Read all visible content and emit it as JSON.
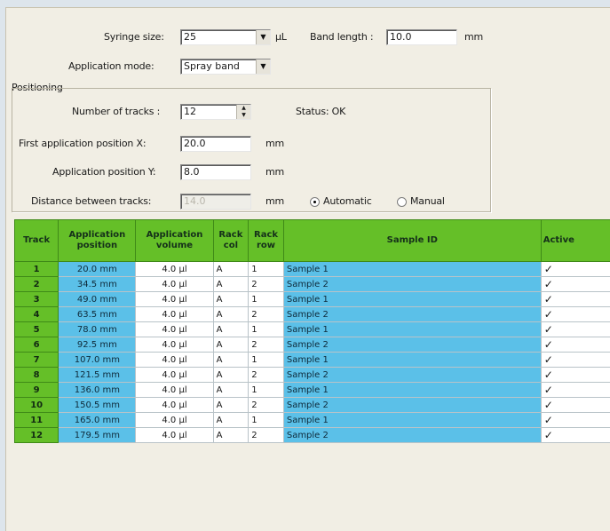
{
  "form": {
    "syringe_label": "Syringe size:",
    "syringe_value": "25",
    "syringe_unit": "µL",
    "band_label": "Band length :",
    "band_value": "10.0",
    "band_unit": "mm",
    "mode_label": "Application mode:",
    "mode_value": "Spray band"
  },
  "positioning": {
    "group_label": "Positioning",
    "tracks_label": "Number of tracks :",
    "tracks_value": "12",
    "status_label": "Status: OK",
    "first_x_label": "First application position X:",
    "first_x_value": "20.0",
    "first_x_unit": "mm",
    "pos_y_label": "Application position Y:",
    "pos_y_value": "8.0",
    "pos_y_unit": "mm",
    "distance_label": "Distance between tracks:",
    "distance_value": "14.0",
    "distance_unit": "mm",
    "automatic_label": "Automatic",
    "manual_label": "Manual"
  },
  "table": {
    "headers": {
      "track": "Track",
      "position": "Application position",
      "volume": "Application volume",
      "rack_col": "Rack col",
      "rack_row": "Rack row",
      "sample": "Sample ID",
      "active": "Active"
    },
    "rows": [
      {
        "track": "1",
        "position": "20.0 mm",
        "volume": "4.0 µl",
        "col": "A",
        "row": "1",
        "sample": "Sample 1",
        "active": "✓"
      },
      {
        "track": "2",
        "position": "34.5 mm",
        "volume": "4.0 µl",
        "col": "A",
        "row": "2",
        "sample": "Sample 2",
        "active": "✓"
      },
      {
        "track": "3",
        "position": "49.0 mm",
        "volume": "4.0 µl",
        "col": "A",
        "row": "1",
        "sample": "Sample 1",
        "active": "✓"
      },
      {
        "track": "4",
        "position": "63.5 mm",
        "volume": "4.0 µl",
        "col": "A",
        "row": "2",
        "sample": "Sample 2",
        "active": "✓"
      },
      {
        "track": "5",
        "position": "78.0 mm",
        "volume": "4.0 µl",
        "col": "A",
        "row": "1",
        "sample": "Sample 1",
        "active": "✓"
      },
      {
        "track": "6",
        "position": "92.5 mm",
        "volume": "4.0 µl",
        "col": "A",
        "row": "2",
        "sample": "Sample 2",
        "active": "✓"
      },
      {
        "track": "7",
        "position": "107.0 mm",
        "volume": "4.0 µl",
        "col": "A",
        "row": "1",
        "sample": "Sample 1",
        "active": "✓"
      },
      {
        "track": "8",
        "position": "121.5 mm",
        "volume": "4.0 µl",
        "col": "A",
        "row": "2",
        "sample": "Sample 2",
        "active": "✓"
      },
      {
        "track": "9",
        "position": "136.0 mm",
        "volume": "4.0 µl",
        "col": "A",
        "row": "1",
        "sample": "Sample 1",
        "active": "✓"
      },
      {
        "track": "10",
        "position": "150.5 mm",
        "volume": "4.0 µl",
        "col": "A",
        "row": "2",
        "sample": "Sample 2",
        "active": "✓"
      },
      {
        "track": "11",
        "position": "165.0 mm",
        "volume": "4.0 µl",
        "col": "A",
        "row": "1",
        "sample": "Sample 1",
        "active": "✓"
      },
      {
        "track": "12",
        "position": "179.5 mm",
        "volume": "4.0 µl",
        "col": "A",
        "row": "2",
        "sample": "Sample 2",
        "active": "✓"
      }
    ]
  },
  "colors": {
    "header_green": "#65bf28",
    "cell_blue": "#5bc0e8",
    "panel_bg": "#f1eee4"
  }
}
